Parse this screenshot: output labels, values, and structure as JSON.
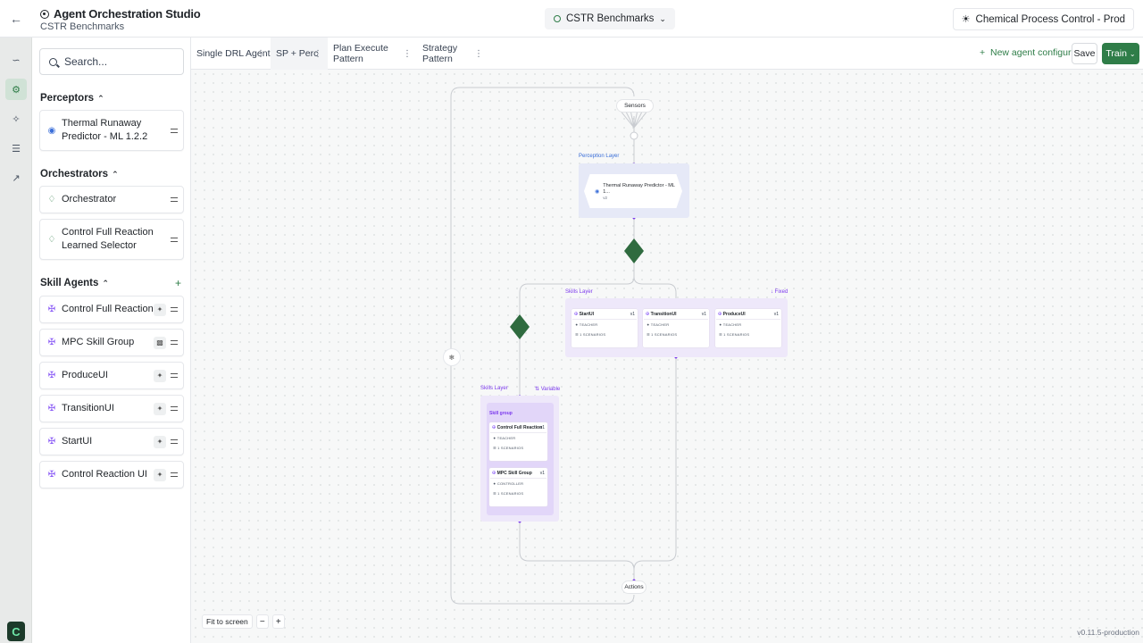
{
  "header": {
    "title": "Agent Orchestration Studio",
    "subtitle": "CSTR Benchmarks",
    "project": "CSTR Benchmarks",
    "environment": "Chemical Process Control - Prod"
  },
  "library": {
    "search_placeholder": "Search...",
    "sections": {
      "perceptors": {
        "title": "Perceptors",
        "items": [
          "Thermal Runaway Predictor - ML 1.2.2"
        ]
      },
      "orchestrators": {
        "title": "Orchestrators",
        "items": [
          "Orchestrator",
          "Control Full Reaction Learned Selector"
        ]
      },
      "skill_agents": {
        "title": "Skill Agents",
        "items": [
          "Control Full Reaction",
          "MPC Skill Group",
          "ProduceUI",
          "TransitionUI",
          "StartUI",
          "Control Reaction UI"
        ]
      }
    }
  },
  "tabs": [
    "Single DRL Agent",
    "SP + Perc",
    "Plan Execute Pattern",
    "Strategy Pattern"
  ],
  "actions": {
    "new_config": "New agent configuration",
    "save": "Save",
    "train": "Train"
  },
  "canvas": {
    "sensors": "Sensors",
    "actions": "Actions",
    "perception_layer": {
      "title": "Perception Layer",
      "node_title": "Thermal Runaway Predictor - ML 1...",
      "node_version": "v2"
    },
    "skills_layer_top": {
      "title": "Skills Layer",
      "mode": "Fixed",
      "cards": [
        {
          "name": "StartUI",
          "version": "v1",
          "role": "TEACHER",
          "scenarios": "1 SCENARIOS"
        },
        {
          "name": "TransitionUI",
          "version": "v1",
          "role": "TEACHER",
          "scenarios": "1 SCENARIOS"
        },
        {
          "name": "ProduceUI",
          "version": "v1",
          "role": "TEACHER",
          "scenarios": "1 SCENARIOS"
        }
      ]
    },
    "skills_layer_bottom": {
      "title": "Skills Layer",
      "mode": "Variable",
      "group_title": "Skill group",
      "cards": [
        {
          "name": "Control Full Reaction",
          "version": "v1",
          "role": "TEACHER",
          "scenarios": "1 SCENARIOS"
        },
        {
          "name": "MPC Skill Group",
          "version": "v1",
          "role": "CONTROLLER",
          "scenarios": "1 SCENARIOS"
        }
      ]
    }
  },
  "footer": {
    "fit_to_screen": "Fit to screen",
    "zoom_out": "−",
    "zoom_in": "+",
    "version": "v0.11.5-production"
  }
}
